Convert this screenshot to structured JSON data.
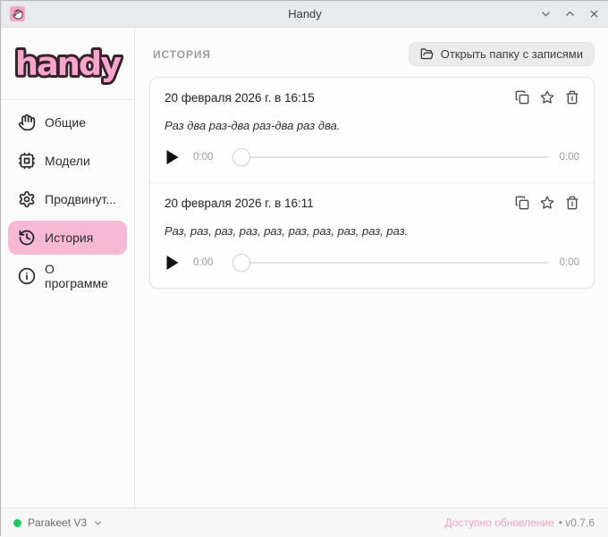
{
  "window": {
    "title": "Handy"
  },
  "sidebar": {
    "logo_text": "handy",
    "items": [
      {
        "label": "Общие",
        "icon": "hand-icon",
        "active": false
      },
      {
        "label": "Модели",
        "icon": "chip-icon",
        "active": false
      },
      {
        "label": "Продвинут...",
        "icon": "gear-icon",
        "active": false
      },
      {
        "label": "История",
        "icon": "history-icon",
        "active": true
      },
      {
        "label": "О программе",
        "icon": "info-icon",
        "active": false
      }
    ]
  },
  "main": {
    "section_title": "ИСТОРИЯ",
    "open_folder_label": "Открыть папку с записями",
    "entries": [
      {
        "date": "20 февраля 2026 г. в 16:15",
        "text": "Раз два раз-два раз-два раз два.",
        "current_time": "0:00",
        "total_time": "0:00"
      },
      {
        "date": "20 февраля 2026 г. в 16:11",
        "text": "Раз, раз, раз, раз, раз, раз, раз, раз, раз, раз.",
        "current_time": "0:00",
        "total_time": "0:00"
      }
    ]
  },
  "statusbar": {
    "model_name": "Parakeet V3",
    "update_link": "Доступно обновление",
    "version": "• v0.7.6"
  },
  "colors": {
    "accent_pink": "#f6b9d4",
    "logo_pink": "#f8a5cc",
    "link_pink": "#f0a2c3",
    "status_green": "#22c55e",
    "titlebar_bg": "#e9eaec"
  }
}
